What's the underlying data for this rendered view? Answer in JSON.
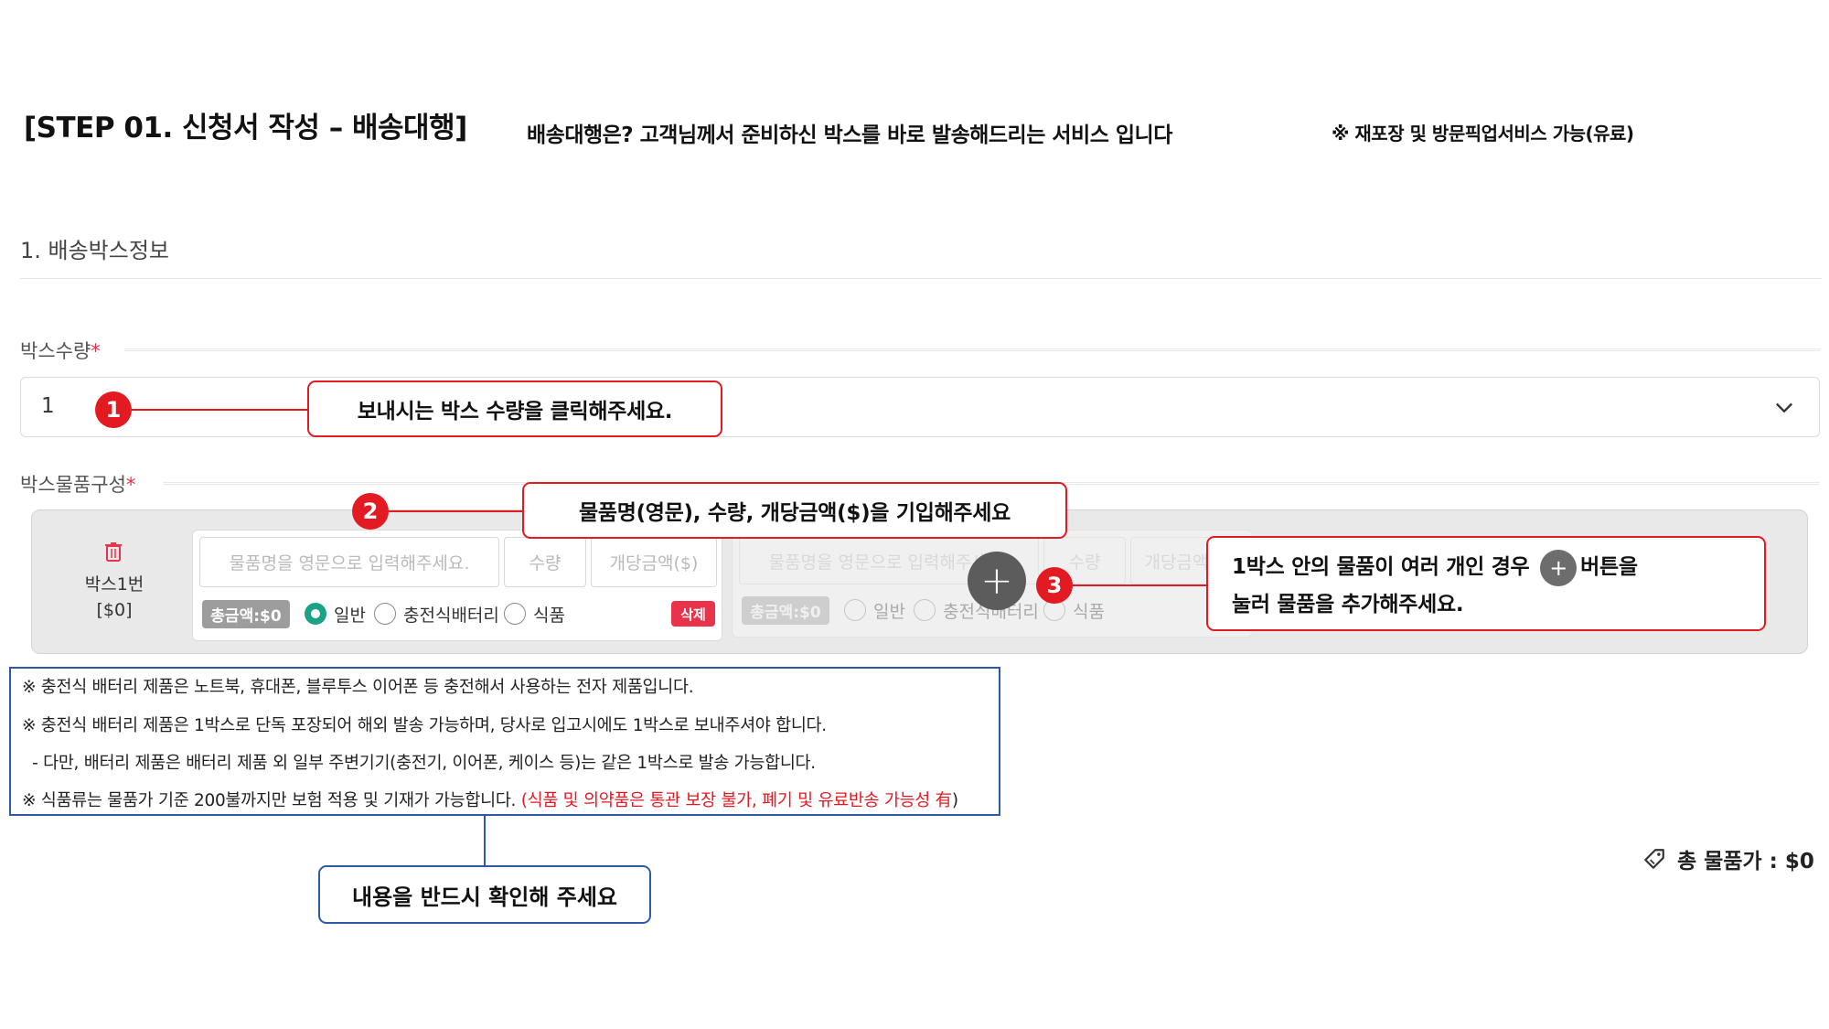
{
  "header": {
    "step_title": "[STEP 01. 신청서 작성 – 배송대행]",
    "description": "배송대행은? 고객님께서 준비하신 박스를 바로 발송해드리는 서비스 입니다",
    "note": "※ 재포장 및 방문픽업서비스 가능(유료)"
  },
  "section": {
    "title": "1. 배송박스정보"
  },
  "box_count": {
    "label": "박스수량",
    "required_mark": "*",
    "value": "1",
    "icon": "chevron-down-icon"
  },
  "box_items": {
    "label": "박스물품구성",
    "required_mark": "*",
    "box": {
      "name": "박스1번",
      "price": "[$0]",
      "delete_icon": "trash-icon"
    },
    "item": {
      "name_placeholder": "물품명을 영문으로 입력해주세요.",
      "qty_placeholder": "수량",
      "price_placeholder": "개당금액($)",
      "total_label": "총금액:$0",
      "types": [
        "일반",
        "충전식배터리",
        "식품"
      ],
      "selected_type": "일반",
      "delete_label": "삭제"
    },
    "add_button_label": "+"
  },
  "callouts": {
    "c1": {
      "number": "1",
      "text": "보내시는 박스 수량을 클릭해주세요."
    },
    "c2": {
      "number": "2",
      "text": "물품명(영문), 수량, 개당금액($)을 기입해주세요"
    },
    "c3": {
      "number": "3",
      "line1_before": "1박스 안의 물품이 여러 개인 경우",
      "plus": "+",
      "line1_after": "버튼을",
      "line2": "눌러 물품을 추가해주세요."
    }
  },
  "notes": {
    "line1": "※ 충전식 배터리 제품은 노트북, 휴대폰, 블루투스 이어폰 등 충전해서 사용하는 전자 제품입니다.",
    "line2": "※ 충전식 배터리 제품은 1박스로 단독 포장되어 해외 발송 가능하며, 당사로 입고시에도 1박스로 보내주셔야 합니다.",
    "line3": "  - 다만, 배터리 제품은 배터리 제품 외 일부 주변기기(충전기, 이어폰, 케이스 등)는 같은 1박스로 발송 가능합니다.",
    "line4_black": "※ 식품류는 물품가 기준 200불까지만 보험 적용 및 기재가 가능합니다. ",
    "line4_red": "(식품 및 의약품은 통관 보장 불가, 폐기 및 유료반송 가능성 有",
    "line4_end": ")",
    "confirm": "내용을 반드시 확인해 주세요"
  },
  "total": {
    "icon": "price-tag-icon",
    "label": "총 물품가 : $0"
  },
  "colors": {
    "callout_red": "#e31a22",
    "note_blue": "#2c5aa8",
    "radio_green": "#1aa387",
    "delete_red": "#e8334a"
  }
}
